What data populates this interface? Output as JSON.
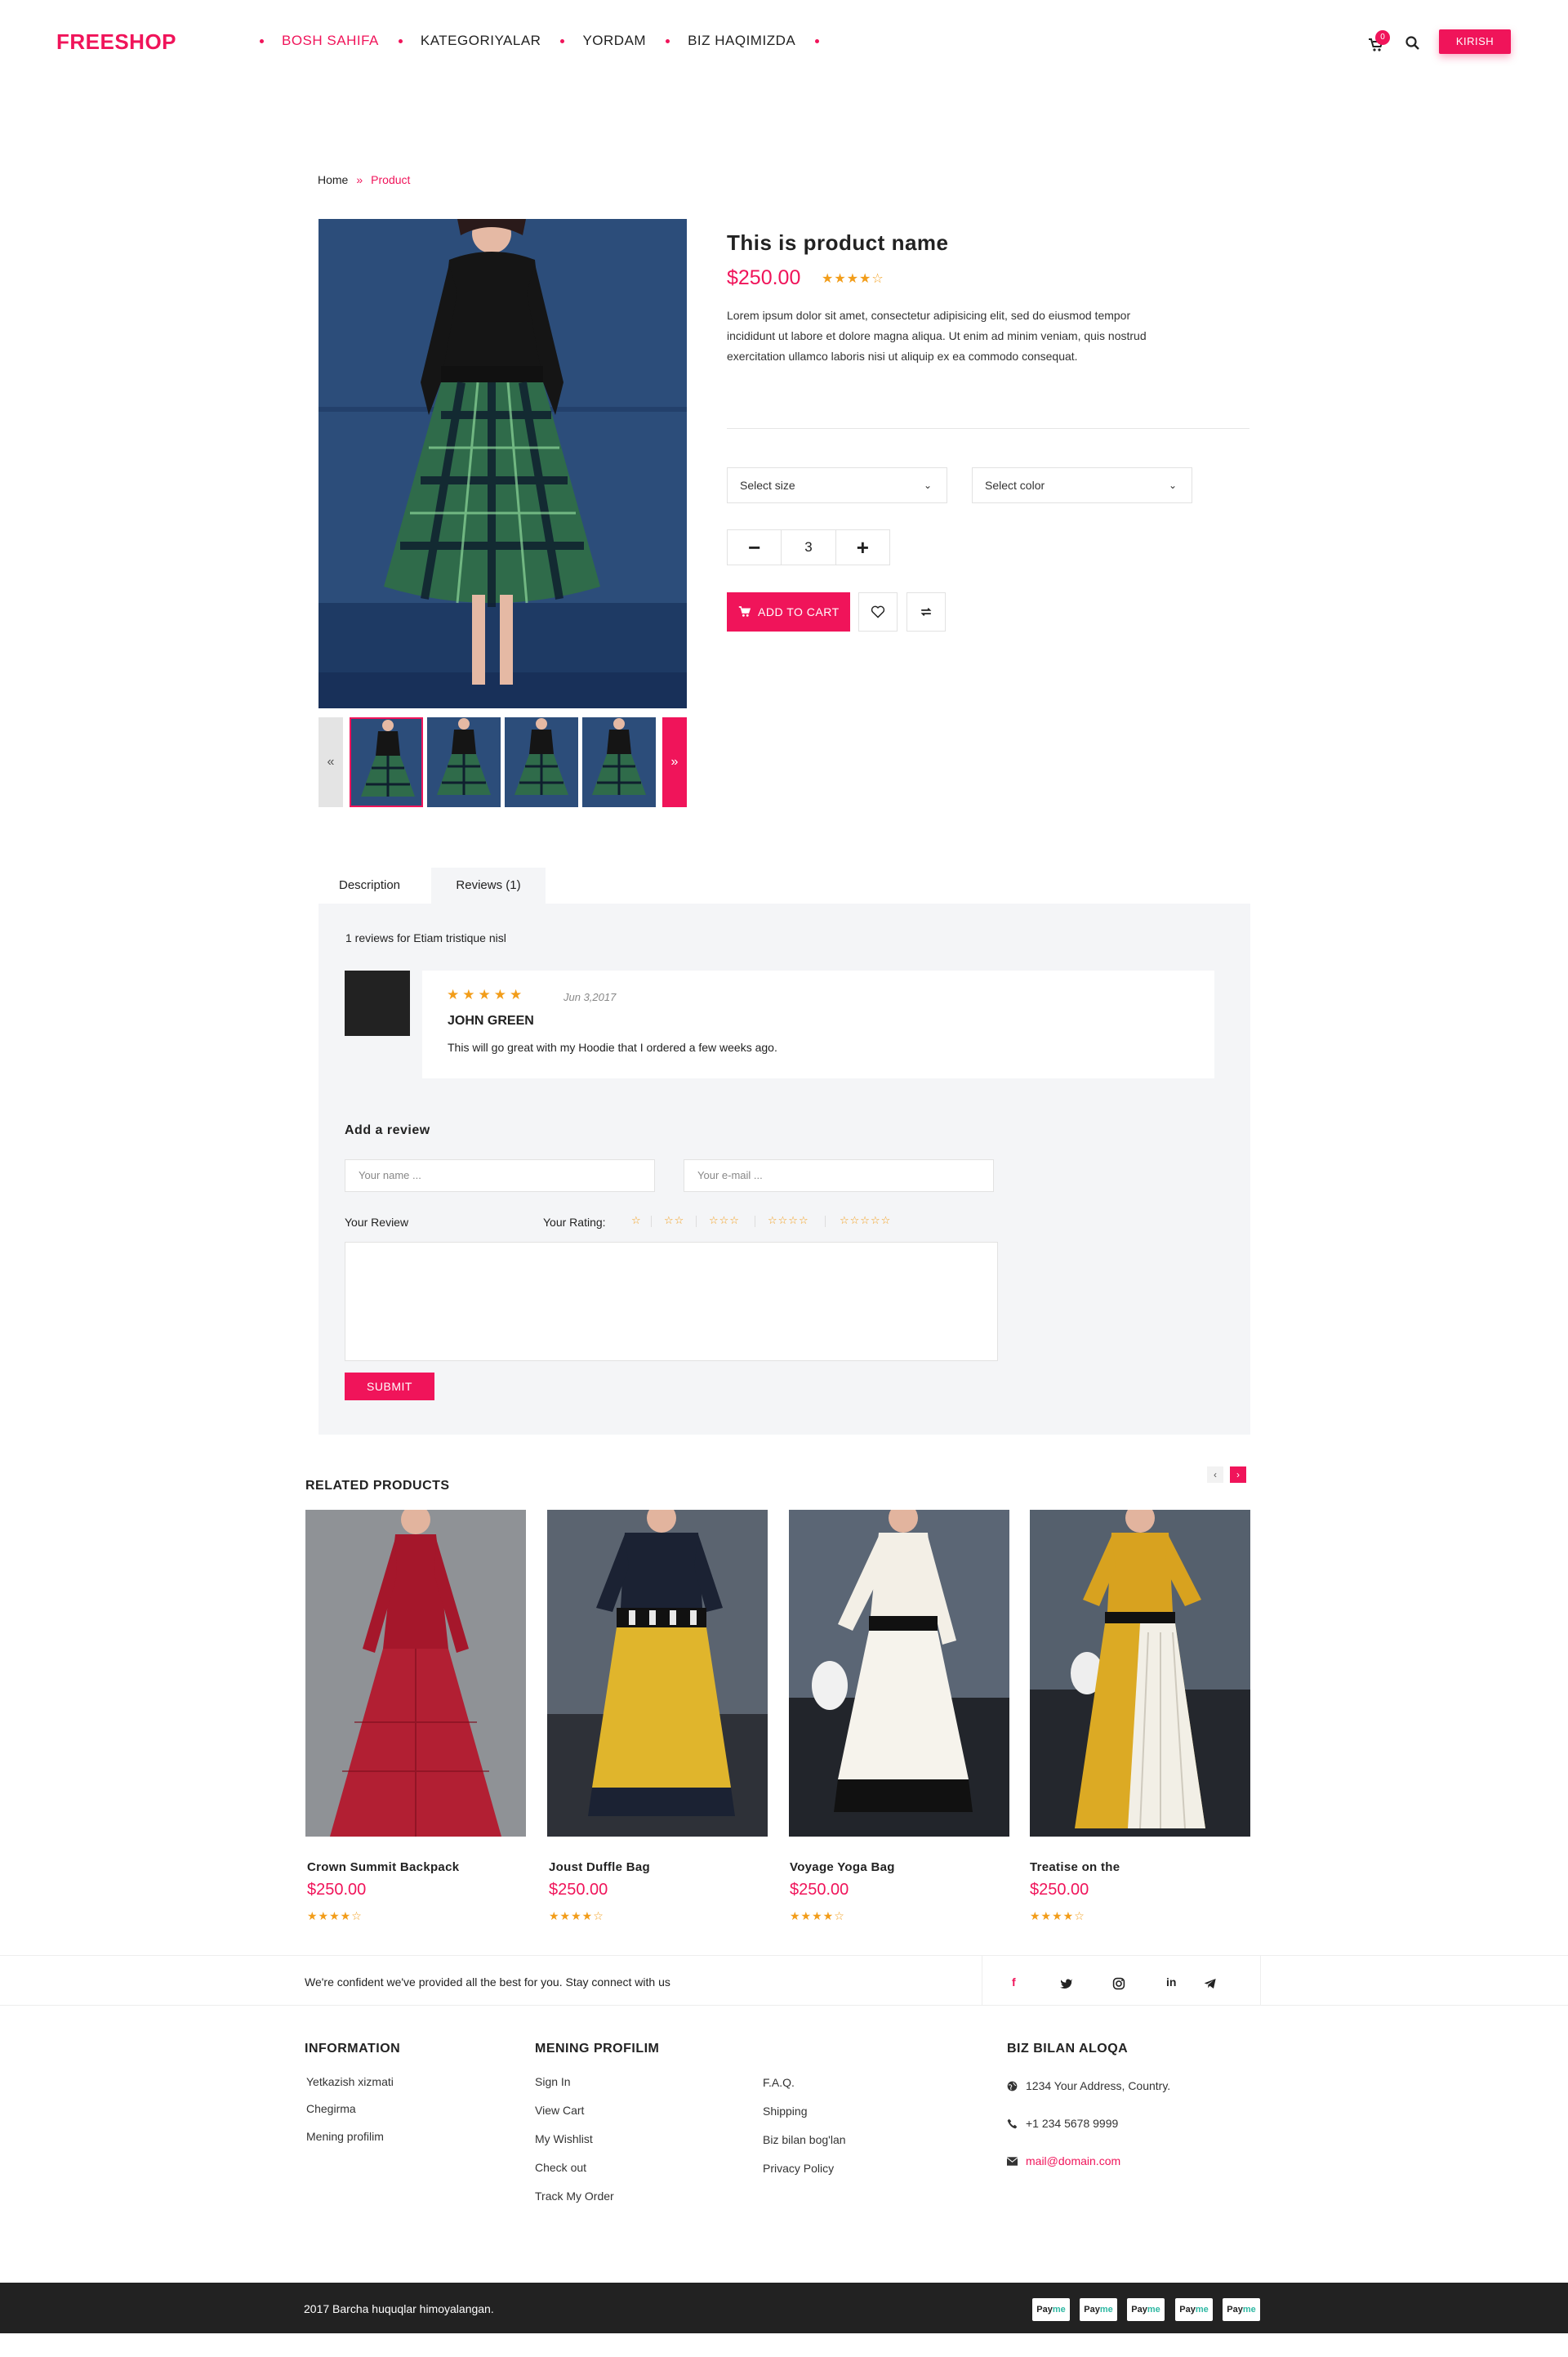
{
  "header": {
    "logo": "FREESHOP",
    "nav": [
      "BOSH SAHIFA",
      "KATEGORIYALAR",
      "YORDAM",
      "BIZ HAQIMIZDA"
    ],
    "cart_count": "0",
    "login_label": "KIRISH"
  },
  "breadcrumb": {
    "home": "Home",
    "sep": "»",
    "current": "Product"
  },
  "product": {
    "name": "This is product name",
    "price": "$250.00",
    "rating": 4,
    "rating_max": 5,
    "description": "Lorem ipsum dolor sit amet, consectetur adipisicing elit, sed do eiusmod tempor incididunt ut labore et dolore magna aliqua. Ut enim ad minim veniam, quis nostrud exercitation ullamco laboris nisi ut aliquip ex ea commodo consequat.",
    "size_placeholder": "Select size",
    "color_placeholder": "Select color",
    "quantity": "3",
    "add_to_cart": "ADD TO CART"
  },
  "tabs": {
    "description": "Description",
    "reviews": "Reviews (1)"
  },
  "reviews": {
    "count_text": "1 reviews for Etiam tristique nisl",
    "items": [
      {
        "rating": 5,
        "date": "Jun 3,2017",
        "name": "JOHN GREEN",
        "text": "This will go great with my Hoodie that I ordered a few weeks ago."
      }
    ]
  },
  "review_form": {
    "title": "Add a review",
    "name_placeholder": "Your name ...",
    "email_placeholder": "Your e-mail ...",
    "review_label": "Your Review",
    "rating_label": "Your Rating:",
    "submit": "SUBMIT"
  },
  "related": {
    "title": "RELATED PRODUCTS",
    "items": [
      {
        "name": "Crown Summit Backpack",
        "price": "$250.00",
        "rating": 4
      },
      {
        "name": "Joust Duffle Bag",
        "price": "$250.00",
        "rating": 4
      },
      {
        "name": "Voyage Yoga Bag",
        "price": "$250.00",
        "rating": 4
      },
      {
        "name": "Treatise on the",
        "price": "$250.00",
        "rating": 4
      }
    ]
  },
  "strip": {
    "text": "We're confident we've provided all the best for you. Stay connect with us",
    "social": [
      "facebook-icon",
      "twitter-icon",
      "instagram-icon",
      "linkedin-icon",
      "telegram-icon"
    ]
  },
  "footer": {
    "info_title": "INFORMATION",
    "info_links": [
      "Yetkazish xizmati",
      "Chegirma",
      "Mening profilim"
    ],
    "profile_title": "MENING PROFILIM",
    "profile_links": [
      "Sign In",
      "View Cart",
      "My Wishlist",
      "Check out",
      "Track My Order"
    ],
    "extra_links": [
      "F.A.Q.",
      "Shipping",
      "Biz bilan bog'lan",
      "Privacy Policy"
    ],
    "contact_title": "BIZ BILAN ALOQA",
    "address": "1234 Your Address, Country.",
    "phone": "+1 234 5678 9999",
    "email": "mail@domain.com",
    "copyright": "2017 Barcha huquqlar himoyalangan.",
    "payments": [
      "PayMe",
      "PayMe",
      "PayMe",
      "PayMe",
      "PayMe"
    ]
  },
  "colors": {
    "accent": "#f0145a",
    "star": "#f29d1a",
    "panel": "#f4f5f7",
    "footer_bar": "#222222"
  }
}
